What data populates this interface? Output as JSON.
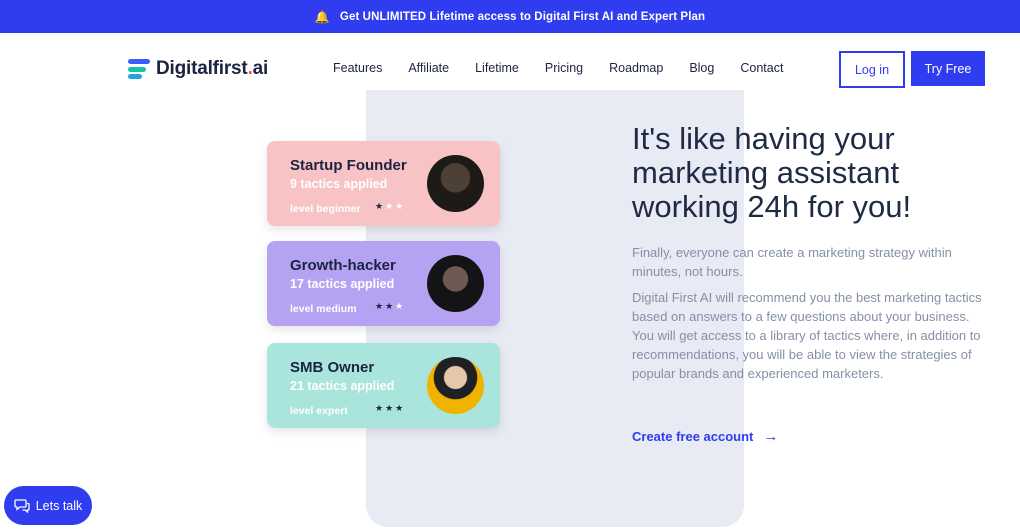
{
  "banner": {
    "icon": "bell-icon",
    "text": "Get UNLIMITED Lifetime access  to Digital First AI and Expert Plan"
  },
  "logo": {
    "name": "Digitalfirst",
    "dot": ".",
    "tld": "ai"
  },
  "nav": {
    "items": [
      "Features",
      "Affiliate",
      "Lifetime",
      "Pricing",
      "Roadmap",
      "Blog",
      "Contact"
    ]
  },
  "header": {
    "login_label": "Log in",
    "try_label": "Try Free"
  },
  "cards": [
    {
      "title": "Startup Founder",
      "tactics": "9 tactics applied",
      "level": "level beginner",
      "stars_filled": 1,
      "stars_total": 3,
      "color": "#f7c3c5"
    },
    {
      "title": "Growth-hacker",
      "tactics": "17 tactics applied",
      "level": "level medium",
      "stars_filled": 2,
      "stars_total": 3,
      "color": "#b5a2f2"
    },
    {
      "title": "SMB Owner",
      "tactics": "21 tactics applied",
      "level": "level expert",
      "stars_filled": 3,
      "stars_total": 3,
      "color": "#a9e4dd"
    }
  ],
  "hero": {
    "headline": "It's like having your marketing assistant working 24h for you!",
    "para1": "Finally, everyone can create a marketing strategy within minutes, not hours.",
    "para2": "Digital First AI will recommend you the best marketing tactics based on answers to a few questions about your business. You will get access to a library of tactics where, in addition to recommendations, you will be able to view the strategies of popular brands and experienced marketers.",
    "cta_label": "Create free account",
    "cta_icon": "arrow-right-icon"
  },
  "chat": {
    "label": "Lets talk",
    "icon": "chat-bubble-icon"
  },
  "colors": {
    "accent": "#2f3cf0",
    "text": "#1f2a44",
    "muted": "#8590a6"
  }
}
